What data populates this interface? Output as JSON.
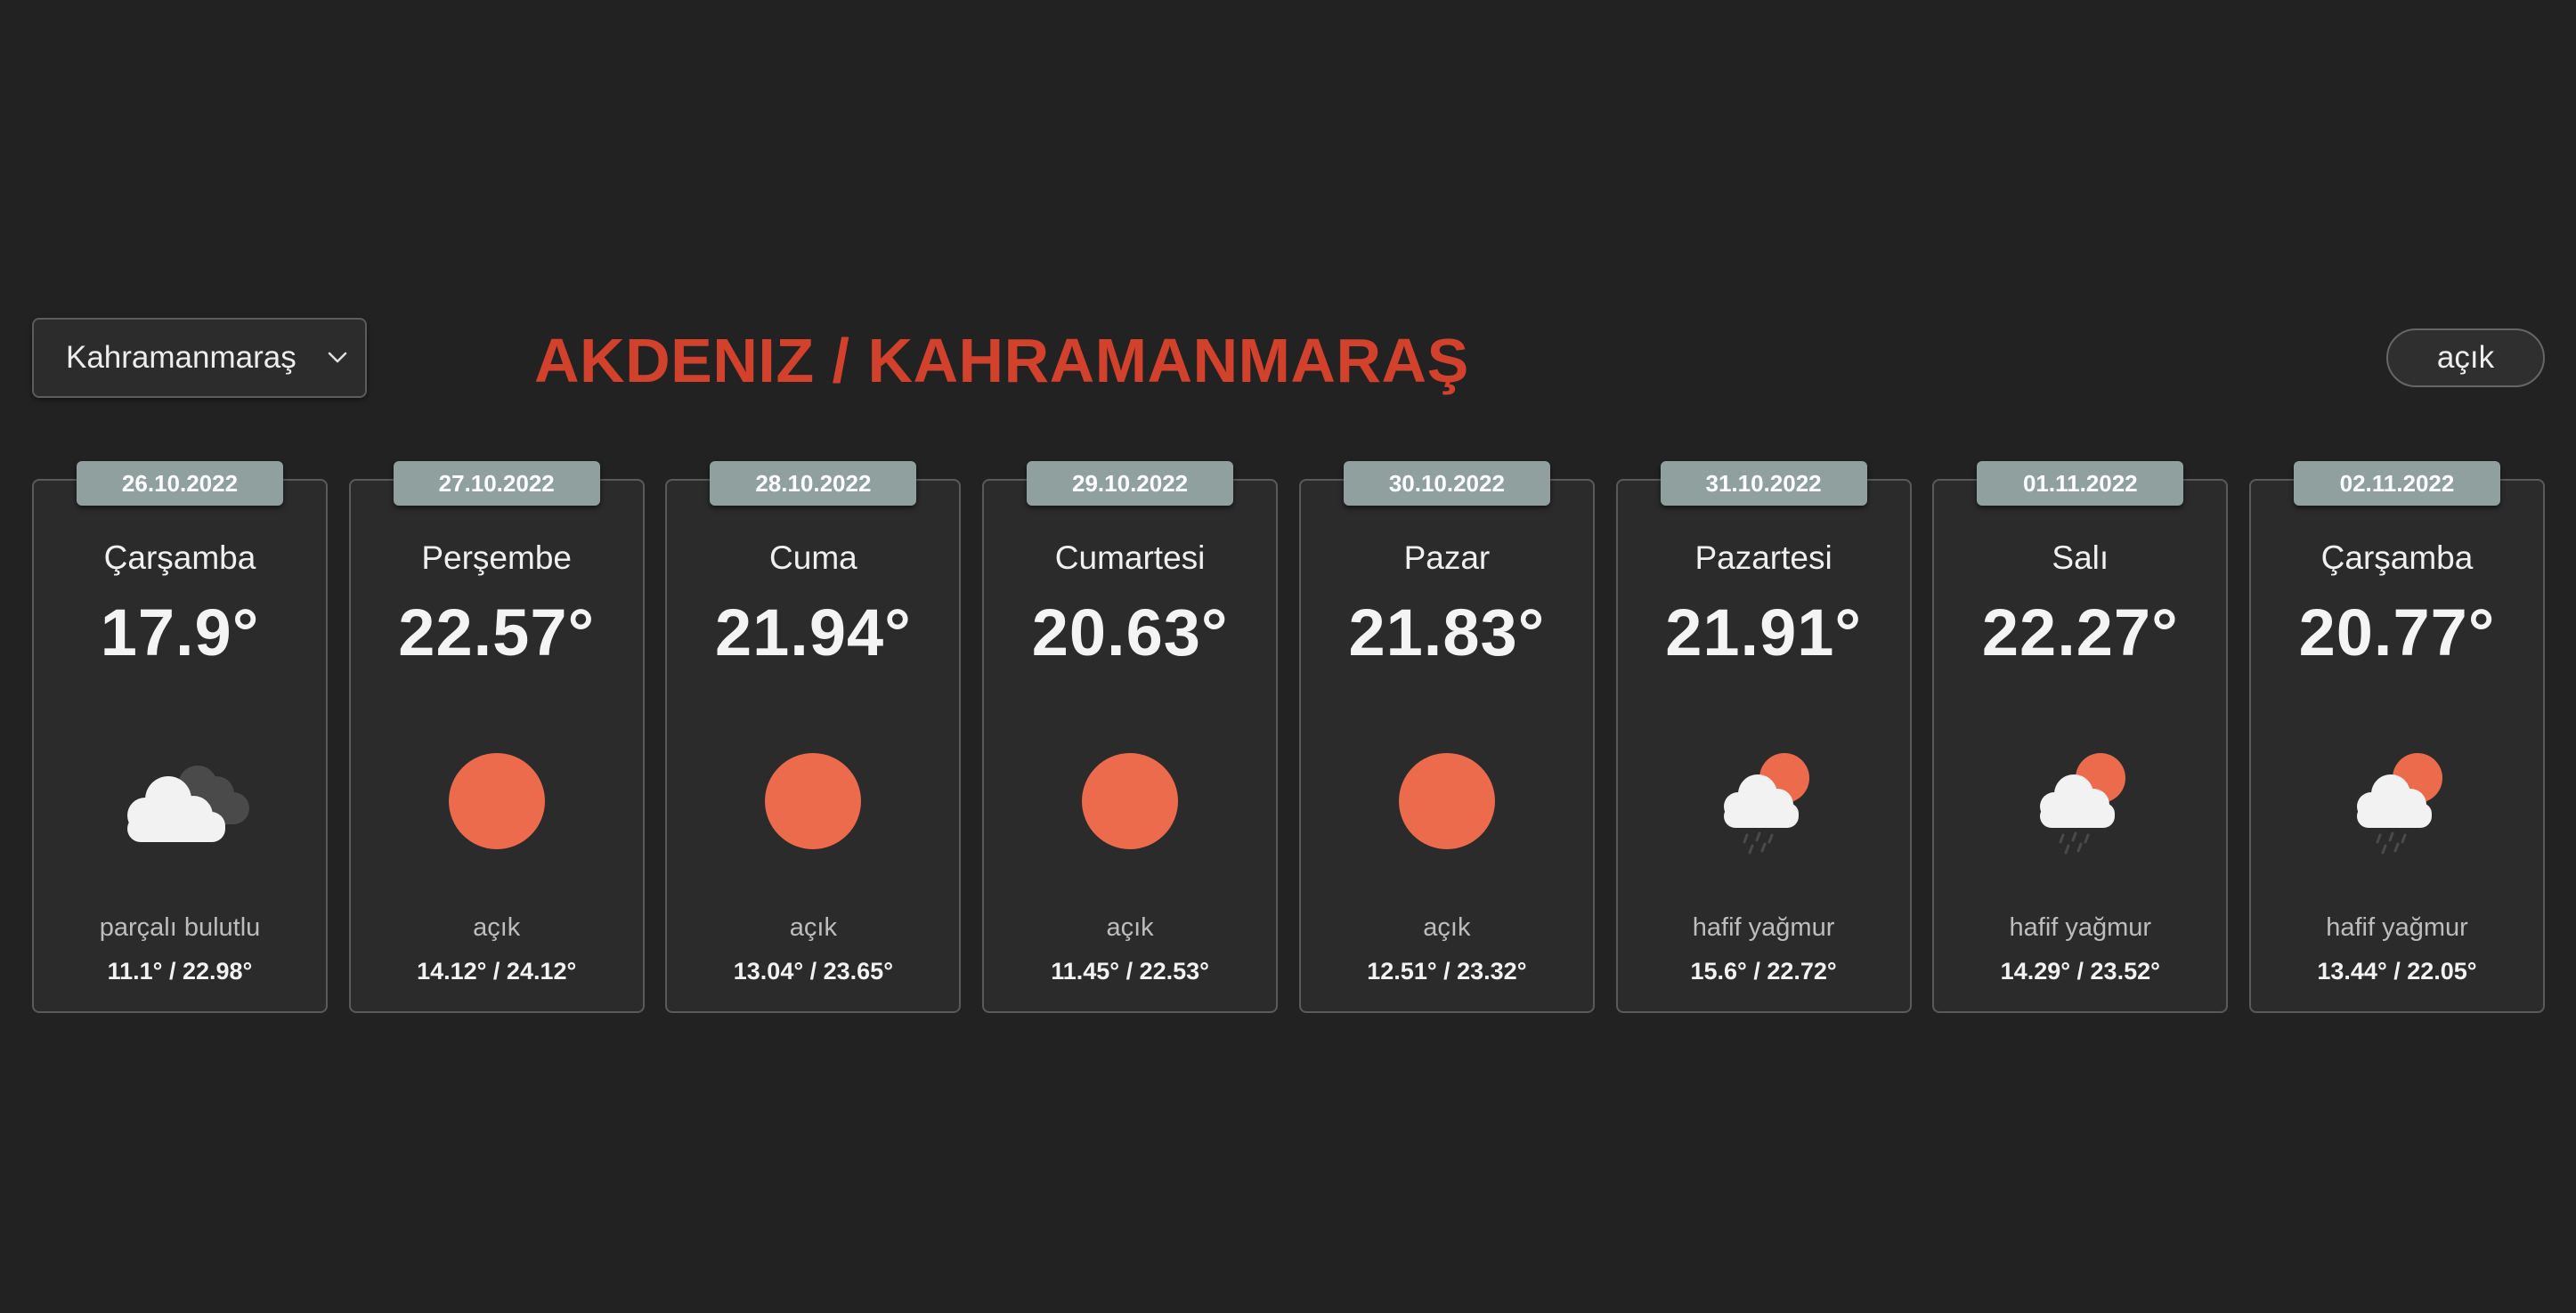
{
  "header": {
    "city_select": {
      "value": "Kahramanmaraş",
      "icon": "chevron-down-icon"
    },
    "title": "AKDENIZ / KAHRAMANMARAŞ",
    "theme_toggle_label": "açık"
  },
  "colors": {
    "background": "#222222",
    "title": "#d1412b",
    "card_background": "#2b2b2b",
    "date_badge": "#8fa09f",
    "sun": "#ec6b4d",
    "cloud": "#f2f2f2"
  },
  "days": [
    {
      "date": "26.10.2022",
      "day": "Çarşamba",
      "temp": "17.9°",
      "icon": "broken-clouds-icon",
      "desc": "parçalı bulutlu",
      "minmax": "11.1° / 22.98°"
    },
    {
      "date": "27.10.2022",
      "day": "Perşembe",
      "temp": "22.57°",
      "icon": "clear-sun-icon",
      "desc": "açık",
      "minmax": "14.12° / 24.12°"
    },
    {
      "date": "28.10.2022",
      "day": "Cuma",
      "temp": "21.94°",
      "icon": "clear-sun-icon",
      "desc": "açık",
      "minmax": "13.04° / 23.65°"
    },
    {
      "date": "29.10.2022",
      "day": "Cumartesi",
      "temp": "20.63°",
      "icon": "clear-sun-icon",
      "desc": "açık",
      "minmax": "11.45° / 22.53°"
    },
    {
      "date": "30.10.2022",
      "day": "Pazar",
      "temp": "21.83°",
      "icon": "clear-sun-icon",
      "desc": "açık",
      "minmax": "12.51° / 23.32°"
    },
    {
      "date": "31.10.2022",
      "day": "Pazartesi",
      "temp": "21.91°",
      "icon": "light-rain-icon",
      "desc": "hafif yağmur",
      "minmax": "15.6° / 22.72°"
    },
    {
      "date": "01.11.2022",
      "day": "Salı",
      "temp": "22.27°",
      "icon": "light-rain-icon",
      "desc": "hafif yağmur",
      "minmax": "14.29° / 23.52°"
    },
    {
      "date": "02.11.2022",
      "day": "Çarşamba",
      "temp": "20.77°",
      "icon": "light-rain-icon",
      "desc": "hafif yağmur",
      "minmax": "13.44° / 22.05°"
    }
  ]
}
